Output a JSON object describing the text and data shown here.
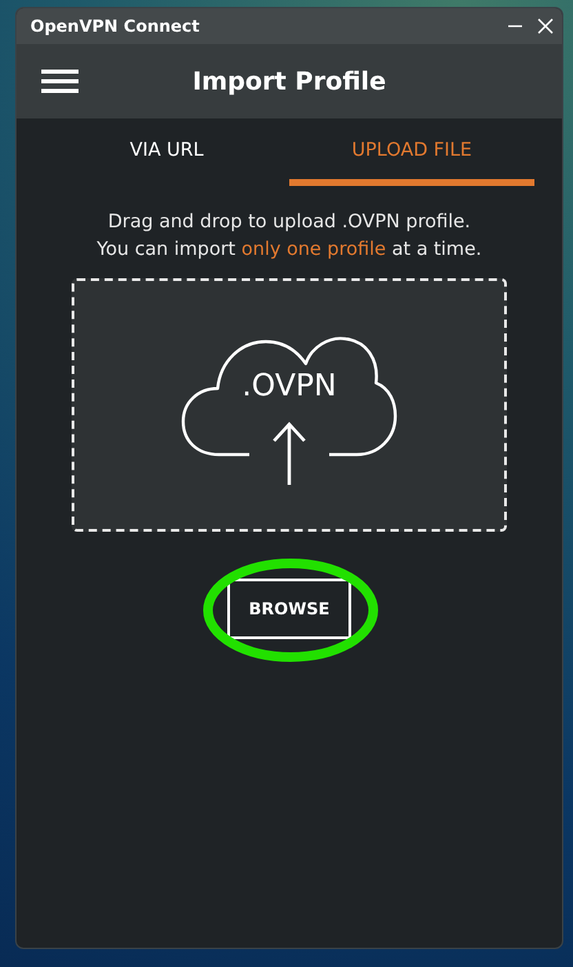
{
  "window": {
    "title": "OpenVPN Connect"
  },
  "header": {
    "title": "Import Profile"
  },
  "tabs": [
    {
      "label": "VIA URL",
      "selected": false
    },
    {
      "label": "UPLOAD FILE",
      "selected": true
    }
  ],
  "message": {
    "line_1": "Drag and drop to upload .OVPN profile.",
    "line_2": [
      {
        "text": "You can import ",
        "emphasis": false
      },
      {
        "text": "only one profile",
        "emphasis": true
      },
      {
        "text": " at a time.",
        "emphasis": false
      }
    ]
  },
  "dropzone": {
    "label": ".OVPN"
  },
  "browse_button": {
    "label": "BROWSE",
    "highlighted": true
  }
}
